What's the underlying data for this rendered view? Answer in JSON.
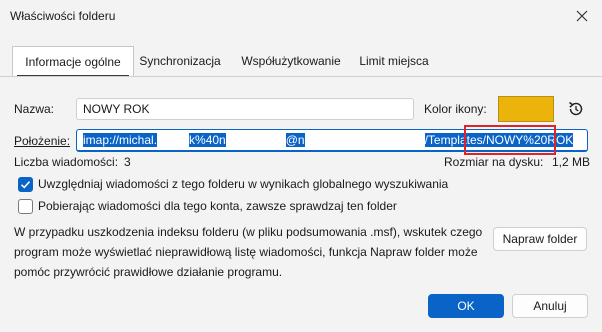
{
  "window": {
    "title": "Właściwości folderu",
    "close_icon": "close-icon"
  },
  "tabs": [
    {
      "label": "Informacje ogólne",
      "active": true
    },
    {
      "label": "Synchronizacja"
    },
    {
      "label": "Współużytkowanie"
    },
    {
      "label": "Limit miejsca"
    }
  ],
  "name": {
    "label": "Nazwa:",
    "value": "NOWY ROK"
  },
  "icon_color": {
    "label": "Kolor ikony:",
    "color": "#ecb30a",
    "reset_icon": "reset-icon"
  },
  "location": {
    "label": "Położenie:",
    "value_part1": "imap://michal.",
    "value_part2": "k%40n",
    "value_part3": "@n",
    "value_part4": "/Templates",
    "value_part5": "/NOWY%20ROK"
  },
  "stats": {
    "message_count_label": "Liczba wiadomości:",
    "message_count": "3",
    "disk_size_label": "Rozmiar na dysku:",
    "disk_size": "1,2 MB"
  },
  "options": {
    "include_global_search": {
      "label": "Uwzględniaj wiadomości z tego folderu w wynikach globalnego wyszukiwania",
      "checked": true
    },
    "always_check": {
      "label": "Pobierając wiadomości dla tego konta, zawsze sprawdzaj ten folder",
      "checked": false
    }
  },
  "repair": {
    "info": "W przypadku uszkodzenia indeksu folderu (w pliku podsumowania .msf), wskutek czego program może wyświetlać nieprawidłową listę wiadomości, funkcja Napraw folder może pomóc przywrócić prawidłowe działanie programu.",
    "button": "Napraw folder"
  },
  "footer": {
    "ok": "OK",
    "cancel": "Anuluj"
  }
}
